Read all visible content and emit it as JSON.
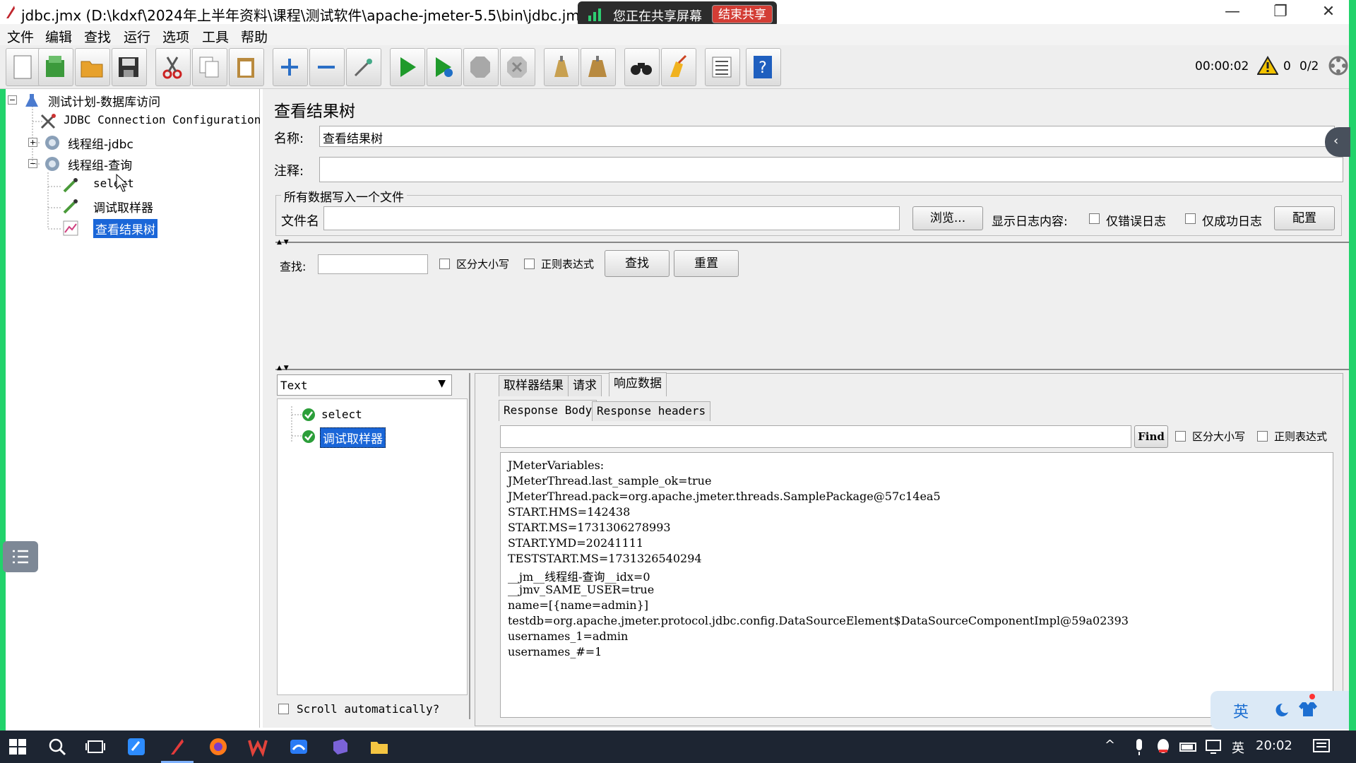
{
  "window": {
    "title": "jdbc.jmx (D:\\kdxf\\2024年上半年资料\\课程\\测试软件\\apache-jmeter-5.5\\bin\\jdbc.jmx) - Apac",
    "minimize": "—",
    "restore": "❐",
    "close": "✕"
  },
  "share_bar": {
    "status": "您正在共享屏幕",
    "stop": "结束共享"
  },
  "menu": [
    "文件",
    "编辑",
    "查找",
    "运行",
    "选项",
    "工具",
    "帮助"
  ],
  "toolbar": {
    "timer": "00:00:02",
    "warnings": "0",
    "threads": "0/2"
  },
  "tree": {
    "root": "测试计划-数据库访问",
    "items": [
      "JDBC Connection Configuration",
      "线程组-jdbc",
      "线程组-查询",
      "select",
      "调试取样器",
      "查看结果树"
    ]
  },
  "panel": {
    "heading": "查看结果树",
    "name_label": "名称:",
    "name_value": "查看结果树",
    "comment_label": "注释:",
    "comment_value": "",
    "file_group": "所有数据写入一个文件",
    "filename_label": "文件名",
    "filename_value": "",
    "browse": "浏览...",
    "log_label": "显示日志内容:",
    "errors_only": "仅错误日志",
    "success_only": "仅成功日志",
    "configure": "配置",
    "search_label": "查找:",
    "search_value": "",
    "case_sensitive": "区分大小写",
    "regex": "正则表达式",
    "find_btn": "查找",
    "reset_btn": "重置"
  },
  "results": {
    "renderer": "Text",
    "samples": [
      "select",
      "调试取样器"
    ],
    "scroll_auto": "Scroll automatically?"
  },
  "result_tabs": [
    "取样器结果",
    "请求",
    "响应数据"
  ],
  "sub_tabs": [
    "Response Body",
    "Response headers"
  ],
  "response_search": {
    "value": "",
    "find": "Find",
    "case_sensitive": "区分大小写",
    "regex": "正则表达式"
  },
  "response_lines": [
    "JMeterVariables:",
    "JMeterThread.last_sample_ok=true",
    "JMeterThread.pack=org.apache.jmeter.threads.SamplePackage@57c14ea5",
    "START.HMS=142438",
    "START.MS=1731306278993",
    "START.YMD=20241111",
    "TESTSTART.MS=1731326540294",
    "__jm__线程组-查询__idx=0",
    "__jmv_SAME_USER=true",
    "name=[{name=admin}]",
    "testdb=org.apache.jmeter.protocol.jdbc.config.DataSourceElement$DataSourceComponentImpl@59a02393",
    "usernames_1=admin",
    "usernames_#=1"
  ],
  "ime": {
    "label": "英"
  },
  "taskbar": {
    "time": "20:02",
    "lang": "英"
  },
  "colors": {
    "share_green": "#22d36b",
    "selection": "#1a66d8",
    "stop_red": "#d33d35"
  }
}
